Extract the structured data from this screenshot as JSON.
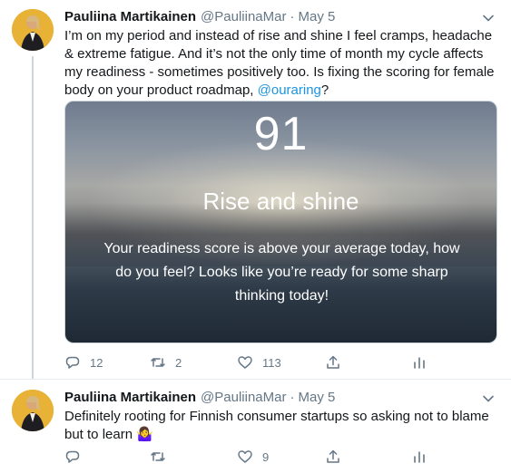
{
  "tweets": [
    {
      "author_name": "Pauliina Martikainen",
      "handle": "@PauliinaMar",
      "separator": "·",
      "date": "May 5",
      "text_before": "I’m on my period and instead of rise and shine I feel cramps, headache & extreme fatigue. And it’s not the only time of month my cycle affects my readiness - sometimes positively too. Is fixing the scoring for female body on your product roadmap, ",
      "mention": "@ouraring",
      "text_after": "?",
      "media": {
        "score": "91",
        "headline": "Rise and shine",
        "message": "Your readiness score is above your average today, how do you feel? Looks like you’re ready for some sharp thinking today!"
      },
      "reply_count": "12",
      "retweet_count": "2",
      "like_count": "113"
    },
    {
      "author_name": "Pauliina Martikainen",
      "handle": "@PauliinaMar",
      "separator": "·",
      "date": "May 5",
      "text": "Definitely rooting for Finnish consumer startups so asking not to blame but to learn ",
      "emoji": "🤷‍♀️",
      "reply_count": "",
      "retweet_count": "",
      "like_count": "9"
    }
  ],
  "colors": {
    "text": "#14171a",
    "secondary": "#657786",
    "link": "#1b95e0",
    "thread_line": "#ccd6dd"
  },
  "icons": [
    "chevron-down-icon",
    "reply-icon",
    "retweet-icon",
    "like-icon",
    "share-icon",
    "analytics-icon"
  ]
}
